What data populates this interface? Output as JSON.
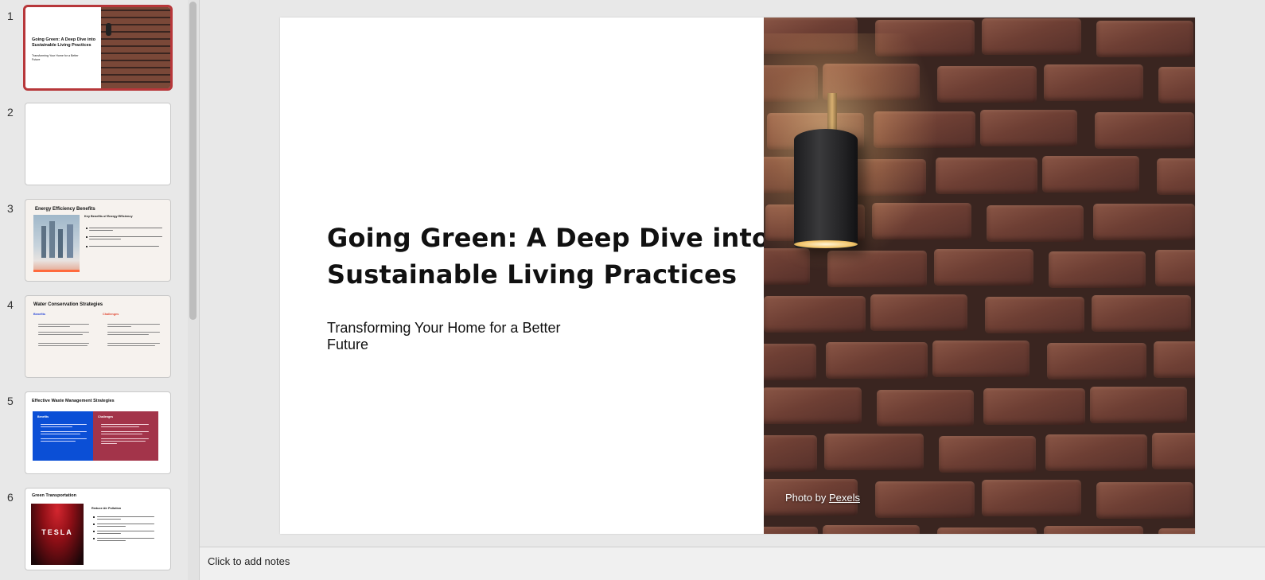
{
  "sidebar": {
    "slides": [
      {
        "num": "1",
        "title": "Going Green: A Deep Dive into Sustainable Living Practices",
        "subtitle": "Transforming Your Home for a Better Future"
      },
      {
        "num": "2"
      },
      {
        "num": "3",
        "title": "Energy Efficiency Benefits",
        "heading": "Key Benefits of Energy Efficiency"
      },
      {
        "num": "4",
        "title": "Water Conservation Strategies",
        "col1": "Benefits",
        "col2": "Challenges"
      },
      {
        "num": "5",
        "title": "Effective Waste Management Strategies",
        "col1": "Benefits",
        "col2": "Challenges"
      },
      {
        "num": "6",
        "title": "Green Transportation",
        "heading": "Reduce Air Pollution",
        "brand": "TESLA"
      }
    ]
  },
  "slide": {
    "title": "Going Green: A Deep Dive into Sustainable Living Practices",
    "subtitle": "Transforming Your Home for a Better Future",
    "photo_credit_prefix": "Photo by ",
    "photo_credit_link": "Pexels"
  },
  "notes": {
    "placeholder": "Click to add notes"
  },
  "colors": {
    "selection": "#b7373a",
    "blue_panel": "#0b4fd6",
    "red_panel": "#a3344a"
  }
}
